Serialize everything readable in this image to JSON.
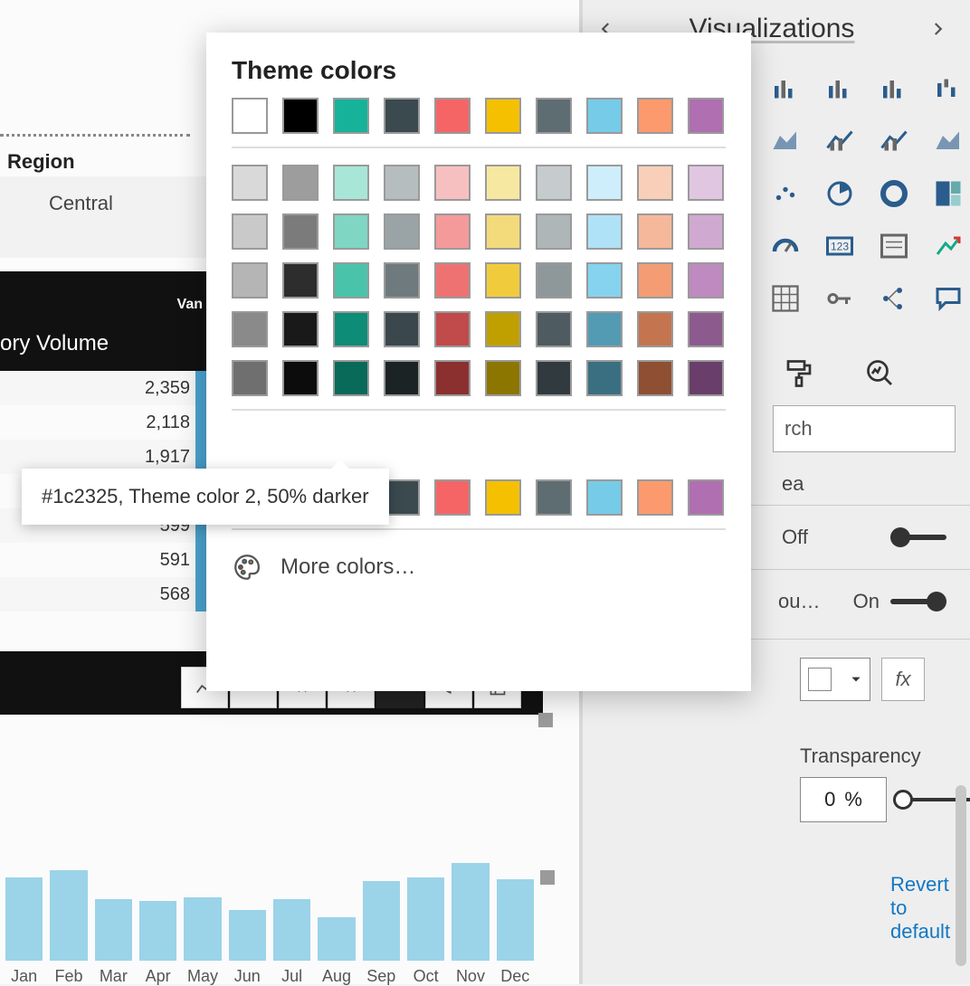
{
  "region": {
    "label": "Region",
    "value": "Central"
  },
  "band": {
    "van": "Van",
    "ory": "ory Volume"
  },
  "bar_rows": [
    "2,359",
    "2,118",
    "1,917",
    "",
    "599",
    "591",
    "568"
  ],
  "mini_chart": {
    "labels": [
      "Jan",
      "Feb",
      "Mar",
      "Apr",
      "May",
      "Jun",
      "Jul",
      "Aug",
      "Sep",
      "Oct",
      "Nov",
      "Dec"
    ],
    "heights": [
      92,
      100,
      68,
      66,
      70,
      56,
      68,
      48,
      88,
      92,
      108,
      90
    ]
  },
  "right": {
    "title": "Visualizations",
    "search_placeholder": "rch",
    "section1": "ea",
    "toggle_off": "Off",
    "toggle_on_trunc": "ou…",
    "toggle_on": "On",
    "transparency_label": "Transparency",
    "transparency_value": "0",
    "transparency_unit": "%",
    "revert": "Revert to default",
    "fx": "fx"
  },
  "picker": {
    "title": "Theme colors",
    "row_main": [
      "#ffffff",
      "#000000",
      "#16b39a",
      "#3a4a4f",
      "#f56565",
      "#f5c000",
      "#5e6d72",
      "#76cbe8",
      "#fc9a6e",
      "#b06fb0"
    ],
    "shades": [
      [
        "#d9d9d9",
        "#9d9d9d",
        "#a8e6d8",
        "#b6bdbf",
        "#f7c0c0",
        "#f6e8a1",
        "#c6cccd",
        "#cfeefb",
        "#f9cfba",
        "#e1c6e1"
      ],
      [
        "#c9c9c9",
        "#7b7b7b",
        "#7fd6c3",
        "#9aa3a6",
        "#f49a9a",
        "#f3da7a",
        "#aeb6b8",
        "#afe2f6",
        "#f6b89a",
        "#d0a9d0"
      ],
      [
        "#b5b5b5",
        "#2d2d2d",
        "#49c4ab",
        "#6e7a7e",
        "#ef7272",
        "#f0cc3d",
        "#8e989b",
        "#86d3ef",
        "#f49d74",
        "#bf8abf"
      ],
      [
        "#8a8a8a",
        "#191919",
        "#0d8c77",
        "#3a484d",
        "#c14a4a",
        "#bfa000",
        "#4e5b60",
        "#539ab3",
        "#c47550",
        "#8d5a8d"
      ],
      [
        "#6f6f6f",
        "#0c0c0c",
        "#0a6a59",
        "#1c2325",
        "#8c2f2f",
        "#8c7600",
        "#313a3e",
        "#3a6f82",
        "#8f4f33",
        "#6a3e6a"
      ]
    ],
    "row_recent": [
      "#ffffff",
      "#000000",
      "#16b39a",
      "#3a4a4f",
      "#f56565",
      "#f5c000",
      "#5e6d72",
      "#76cbe8",
      "#fc9a6e",
      "#b06fb0"
    ],
    "more": "More colors…",
    "tooltip": "#1c2325, Theme color 2, 50% darker"
  },
  "viz_icons": [
    "stacked-bar",
    "clustered-column",
    "stacked-column-100",
    "waterfall",
    "area",
    "line-column",
    "line-clustered",
    "ribbon",
    "scatter",
    "pie",
    "donut",
    "treemap",
    "gauge",
    "card",
    "multi-row-card",
    "kpi",
    "matrix",
    "key-influencers",
    "decomposition",
    "qna"
  ],
  "toolbar_icons": [
    "line",
    "download",
    "sort-down",
    "sort-down-alt",
    "dark-block",
    "filter",
    "focus",
    "more"
  ]
}
